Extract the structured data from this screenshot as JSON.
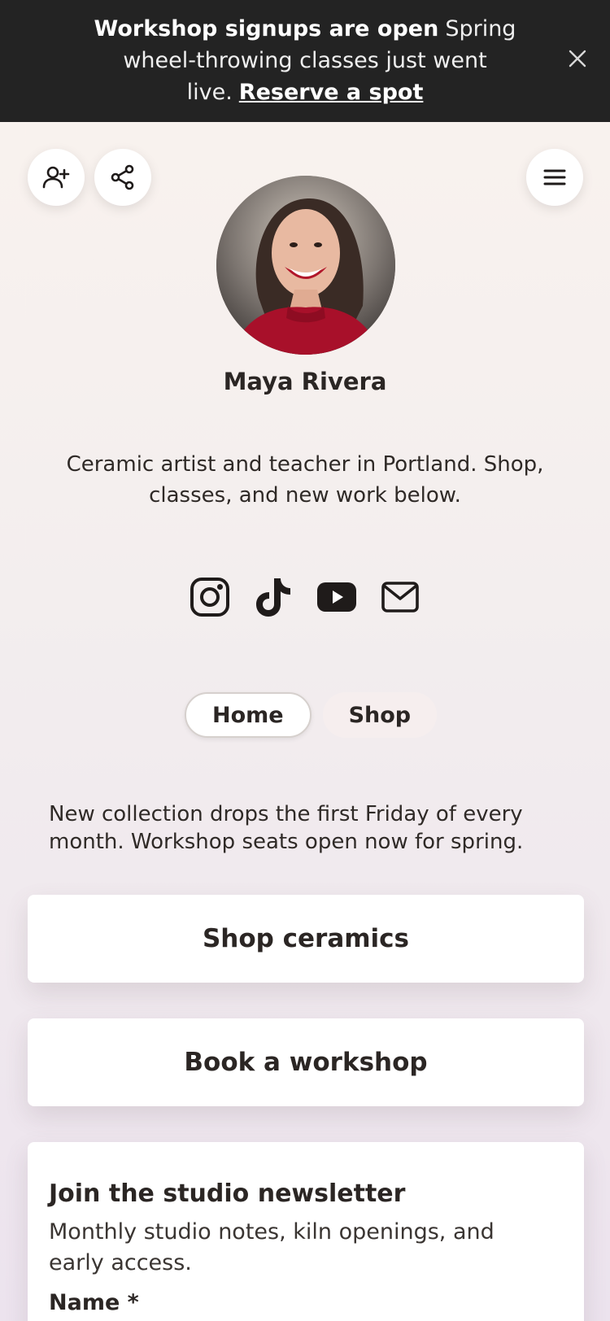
{
  "banner": {
    "title": "Workshop signups are open",
    "message": "Spring wheel-throwing classes just went live.",
    "link_label": "Reserve a spot"
  },
  "icons": {
    "close": "close-icon",
    "follow": "user-plus-icon",
    "share": "share-icon",
    "menu": "hamburger-menu-icon",
    "socials": [
      "instagram-icon",
      "tiktok-icon",
      "youtube-icon",
      "email-icon"
    ]
  },
  "profile": {
    "name": "Maya Rivera",
    "bio": "Ceramic artist and teacher in Portland. Shop, classes, and new work below."
  },
  "tabs": [
    {
      "label": "Home",
      "active": true
    },
    {
      "label": "Shop",
      "active": false
    }
  ],
  "note": "New collection drops the first Friday of every month. Workshop seats open now for spring.",
  "links": [
    {
      "label": "Shop ceramics"
    },
    {
      "label": "Book a workshop"
    }
  ],
  "newsletter": {
    "title": "Join the studio newsletter",
    "description": "Monthly studio notes, kiln openings, and early access.",
    "name_label": "Name *"
  },
  "colors": {
    "banner_bg": "#232323",
    "text": "#2b2624",
    "card_bg": "#ffffff"
  }
}
